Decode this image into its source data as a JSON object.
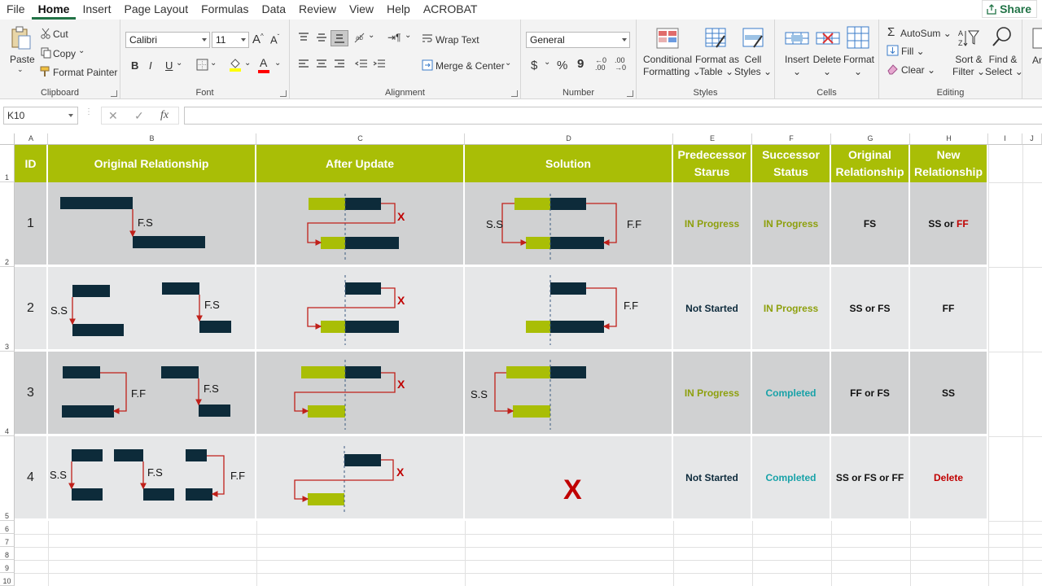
{
  "menu": {
    "items": [
      "File",
      "Home",
      "Insert",
      "Page Layout",
      "Formulas",
      "Data",
      "Review",
      "View",
      "Help",
      "ACROBAT"
    ],
    "active": "Home",
    "share": "Share"
  },
  "ribbon": {
    "clipboard": {
      "paste": "Paste",
      "cut": "Cut",
      "copy": "Copy",
      "format_painter": "Format Painter",
      "label": "Clipboard"
    },
    "font": {
      "name": "Calibri",
      "size": "11",
      "bold": "B",
      "italic": "I",
      "underline": "U",
      "label": "Font"
    },
    "alignment": {
      "wrap_text": "Wrap Text",
      "merge_center": "Merge & Center",
      "label": "Alignment"
    },
    "number": {
      "format": "General",
      "currency": "$",
      "percent": "%",
      "comma": "9",
      "label": "Number"
    },
    "styles": {
      "conditional": "Conditional",
      "conditional2": "Formatting",
      "format_table": "Format as",
      "format_table2": "Table",
      "cell_styles": "Cell",
      "cell_styles2": "Styles",
      "label": "Styles"
    },
    "cells": {
      "insert": "Insert",
      "delete": "Delete",
      "format": "Format",
      "label": "Cells"
    },
    "editing": {
      "autosum": "AutoSum",
      "fill": "Fill",
      "clear": "Clear",
      "sort": "Sort &",
      "sort2": "Filter",
      "find": "Find &",
      "find2": "Select",
      "label": "Editing"
    },
    "partial": "An"
  },
  "formula_bar": {
    "name_box": "K10",
    "cancel": "✕",
    "enter": "✓",
    "fx": "fx",
    "formula": ""
  },
  "columns": [
    "A",
    "B",
    "C",
    "D",
    "E",
    "F",
    "G",
    "H",
    "I",
    "J"
  ],
  "rows": [
    "1",
    "2",
    "3",
    "4",
    "5",
    "6",
    "7",
    "8",
    "9",
    "10"
  ],
  "headers": {
    "id": "ID",
    "original": "Original Relationship",
    "after": "After Update",
    "solution": "Solution",
    "pred": "Predecessor Starus",
    "succ": "Successor Status",
    "orig_rel": "Original Relationship",
    "new_rel": "New Relationship"
  },
  "table": [
    {
      "id": "1",
      "pred": "IN Progress",
      "succ": "IN Progress",
      "orig": "FS",
      "new_a": "SS or ",
      "new_b": "FF"
    },
    {
      "id": "2",
      "pred": "Not Started",
      "succ": "IN Progress",
      "orig": "SS or FS",
      "new_a": "FF",
      "new_b": ""
    },
    {
      "id": "3",
      "pred": "IN Progress",
      "succ": "Completed",
      "orig": "FF or FS",
      "new_a": "SS",
      "new_b": ""
    },
    {
      "id": "4",
      "pred": "Not Started",
      "succ": "Completed",
      "orig": "SS or FS or FF",
      "new_a": "Delete",
      "new_b": ""
    }
  ],
  "diagram_labels": {
    "fs": "F.S",
    "ss": "S.S",
    "ff": "F.F",
    "x": "X"
  },
  "colors": {
    "header_bg": "#a9be06",
    "bar_dark": "#0d2b3a",
    "bar_green": "#a9be06",
    "arrow": "#c0201a",
    "in_progress": "#8ea00e",
    "completed": "#18a2a8",
    "not_started": "#0e2b3c",
    "red": "#c00000",
    "row_dark": "#d0d1d2",
    "row_light": "#e6e7e8"
  }
}
